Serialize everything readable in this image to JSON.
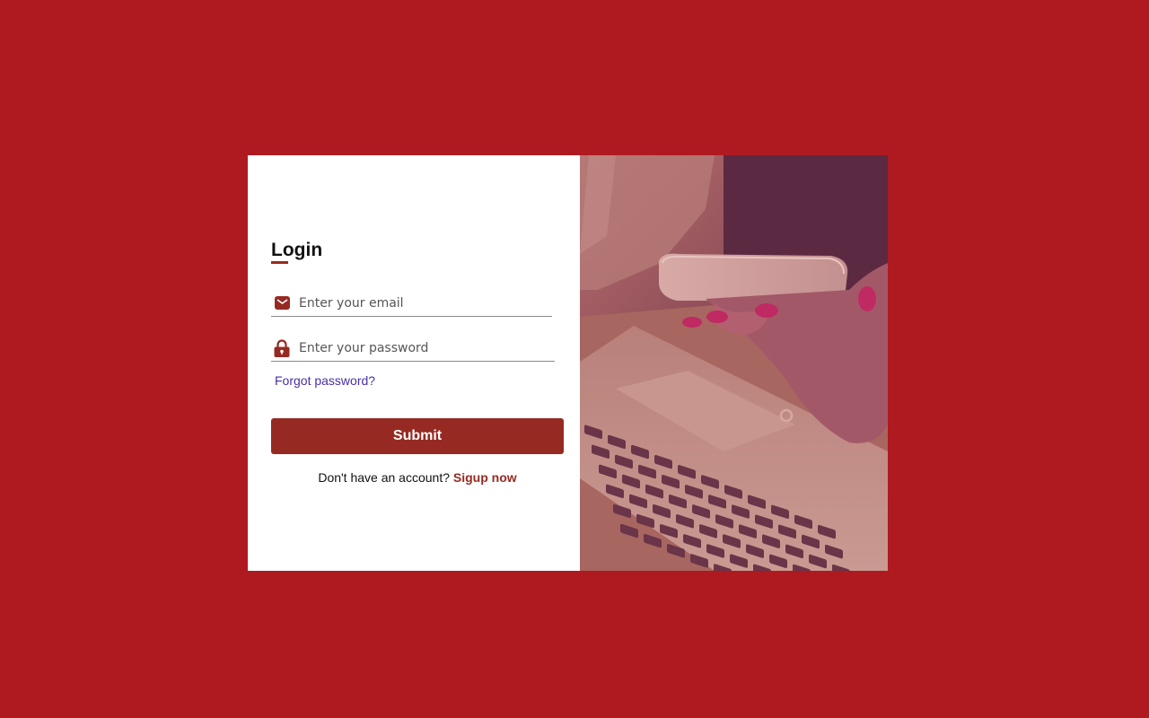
{
  "login": {
    "title": "Login",
    "email_placeholder": "Enter your email",
    "password_placeholder": "Enter your password",
    "forgot_label": "Forgot password?",
    "submit_label": "Submit",
    "signup_prompt": "Don't have an account?",
    "signup_label": "Sigup now"
  },
  "icons": {
    "email": "envelope-icon",
    "password": "lock-icon"
  },
  "colors": {
    "background": "#ae1a20",
    "accent": "#962a22",
    "link": "#4a2fa8"
  }
}
